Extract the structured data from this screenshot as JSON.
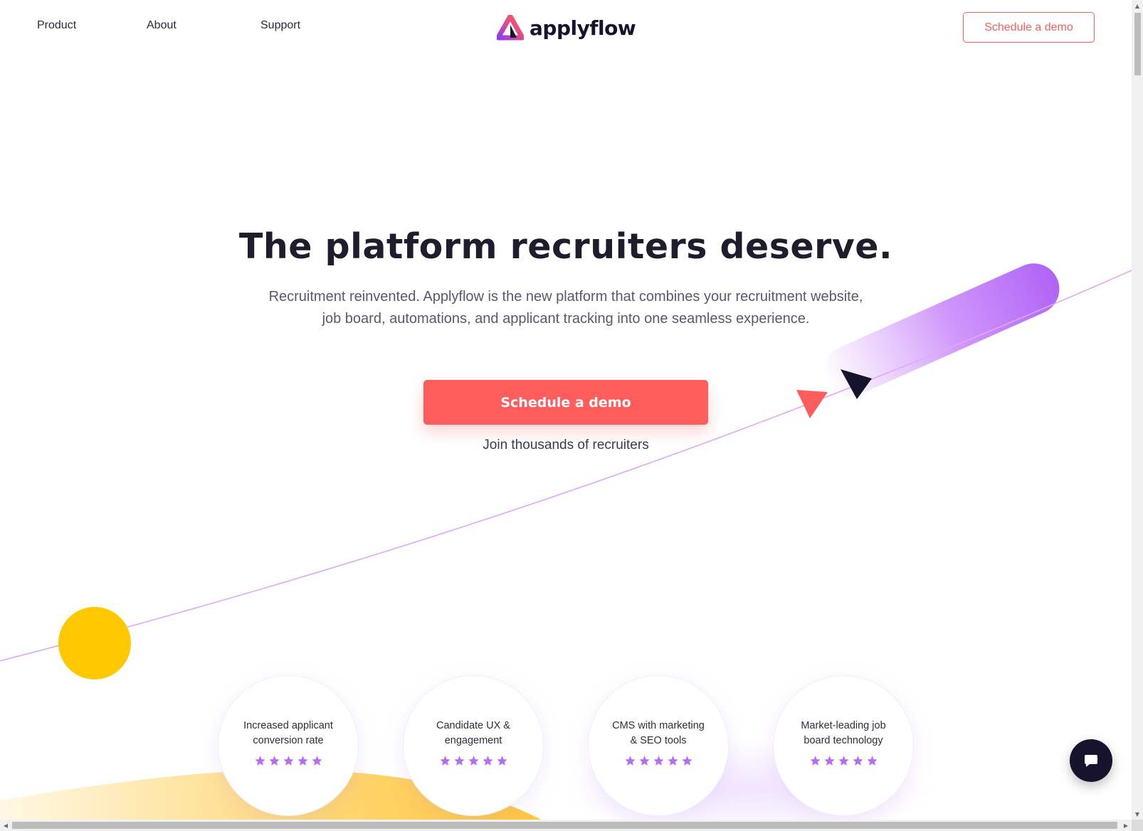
{
  "header": {
    "nav": [
      {
        "label": "Product"
      },
      {
        "label": "About"
      },
      {
        "label": "Support"
      }
    ],
    "logo_text": "applyflow",
    "cta_label": "Schedule a demo"
  },
  "hero": {
    "title": "The platform recruiters deserve.",
    "subtitle_line1": "Recruitment reinvented. Applyflow is the new platform that combines your recruitment website,",
    "subtitle_line2": "job board, automations, and applicant tracking into one seamless experience.",
    "cta_label": "Schedule a demo",
    "note": "Join thousands of recruiters"
  },
  "features": [
    {
      "line1": "Increased applicant",
      "line2": "conversion rate",
      "rating": 5
    },
    {
      "line1": "Candidate UX &",
      "line2": "engagement",
      "rating": 5
    },
    {
      "line1": "CMS with marketing",
      "line2": "& SEO tools",
      "rating": 5
    },
    {
      "line1": "Market-leading job",
      "line2": "board technology",
      "rating": 5
    }
  ],
  "colors": {
    "accent_coral": "#ff5c5c",
    "purple": "#b56cf7",
    "navy": "#16132c",
    "yellow": "#ffc800"
  },
  "icons": {
    "chat": "chat-bubble-icon",
    "star": "star-icon",
    "logo": "applyflow-triangle-logo-icon"
  }
}
